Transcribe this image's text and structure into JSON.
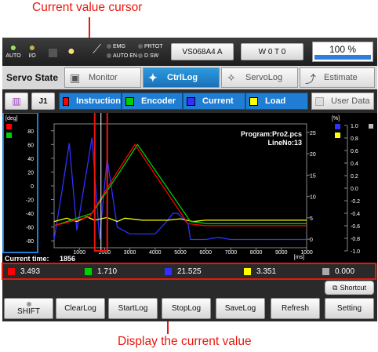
{
  "callouts": {
    "top": "Current value cursor",
    "bottom": "Display the current value"
  },
  "topbar": {
    "auto": "AUTO",
    "io": "I/O",
    "leds": [
      "EMG",
      "PRTOT",
      "AUTO EN",
      "D SW"
    ],
    "box1": "VS068A4 A",
    "box2": "W 0 T 0",
    "percent": "100 %"
  },
  "tabs": {
    "title": "Servo State",
    "monitor": "Monitor",
    "ctrllog": "CtrlLog",
    "servolog": "ServoLog",
    "estimate": "Estimate"
  },
  "legend": {
    "j1": "J1",
    "instruction": "Instruction",
    "encoder": "Encoder",
    "current": "Current",
    "load": "Load",
    "userdata": "User Data"
  },
  "colors": {
    "instruction": "#ff0000",
    "encoder": "#00d000",
    "current": "#3030ff",
    "load": "#ffff00",
    "userdata": "#c0c0c0",
    "accent": "#1f7dd3",
    "callout": "#e8170c"
  },
  "plot": {
    "left_unit": "[deg]",
    "right_unit": "[%]",
    "x_unit": "[ms]",
    "program": "Program:Pro2.pcs",
    "line": "LineNo:13",
    "current_time_label": "Current time:",
    "current_time": "1856",
    "left_ticks": [
      "80",
      "60",
      "40",
      "20",
      "0",
      "-20",
      "-40",
      "-60",
      "-80"
    ],
    "mid_ticks": [
      "25",
      "20",
      "15",
      "10",
      "5",
      "0"
    ],
    "right_ticks": [
      "1.0",
      "0.8",
      "0.6",
      "0.4",
      "0.2",
      "0.0",
      "-0.2",
      "-0.4",
      "-0.6",
      "-0.8",
      "-1.0"
    ],
    "x_ticks": [
      "1000",
      "2000",
      "3000",
      "4000",
      "5000",
      "6000",
      "7000",
      "8000",
      "9000",
      "1000"
    ]
  },
  "chart_data": {
    "type": "line",
    "xlabel": "[ms]",
    "xlim": [
      0,
      10000
    ],
    "ylim_left": [
      -90,
      90
    ],
    "ylim_mid": [
      -2,
      27
    ],
    "cursor_x": 1856,
    "series": [
      {
        "name": "Instruction",
        "x": [
          0,
          1400,
          2500,
          3200,
          5300,
          6000,
          10000
        ],
        "y": [
          -58,
          -45,
          20,
          60,
          -55,
          -58,
          -58
        ]
      },
      {
        "name": "Encoder",
        "x": [
          0,
          1500,
          2600,
          3300,
          5400,
          6100,
          10000
        ],
        "y": [
          -58,
          -40,
          20,
          60,
          -52,
          -55,
          -55
        ]
      },
      {
        "name": "Current",
        "x": [
          0,
          300,
          600,
          900,
          1500,
          1800,
          2100,
          2500,
          3000,
          4000,
          4500,
          4700,
          4900,
          5300,
          5400,
          6000,
          6500,
          7000,
          10000
        ],
        "y": [
          -78,
          -10,
          62,
          -65,
          70,
          -78,
          40,
          -60,
          -70,
          -70,
          -50,
          -40,
          -40,
          -55,
          -78,
          -78,
          -75,
          -78,
          -78
        ]
      },
      {
        "name": "Load",
        "x": [
          0,
          500,
          900,
          1300,
          1600,
          2100,
          2500,
          2800,
          3500,
          4500,
          5000,
          5500,
          6000,
          10000
        ],
        "y": [
          -52,
          -47,
          -52,
          -45,
          -50,
          -46,
          -52,
          -47,
          -50,
          -50,
          -48,
          -52,
          -50,
          -50
        ]
      }
    ]
  },
  "values": [
    "3.493",
    "1.710",
    "21.525",
    "3.351",
    "0.000"
  ],
  "shortcut": "Shortcut",
  "buttons": [
    "SHIFT",
    "ClearLog",
    "StartLog",
    "StopLog",
    "SaveLog",
    "Refresh",
    "Setting"
  ]
}
